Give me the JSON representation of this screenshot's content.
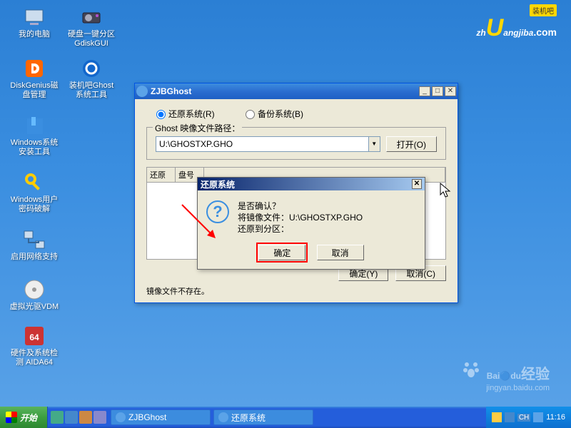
{
  "desktop": {
    "icons": [
      {
        "label": "我的电脑",
        "name": "my-computer"
      },
      {
        "label": "硬盘一键分区GdiskGUI",
        "name": "gdisk-gui"
      },
      {
        "label": "DiskGenius磁盘管理",
        "name": "diskgenius"
      },
      {
        "label": "装机吧Ghost系统工具",
        "name": "zjb-ghost-tool"
      },
      {
        "label": "Windows系统安装工具",
        "name": "windows-install"
      },
      {
        "label": "Windows用户密码破解",
        "name": "password-crack"
      },
      {
        "label": "启用网络支持",
        "name": "enable-network"
      },
      {
        "label": "虚拟光驱VDM",
        "name": "virtual-drive"
      },
      {
        "label": "硬件及系统检测 AIDA64",
        "name": "aida64"
      }
    ]
  },
  "watermark": {
    "logo_pre": "zh",
    "logo_u": "U",
    "logo_post": "angjiba",
    "logo_com": ".com",
    "badge": "装机吧",
    "bottom_brand_pre": "Bai",
    "bottom_brand_post": "du",
    "bottom_brand_cn": "经验",
    "bottom_url": "jingyan.baidu.com"
  },
  "main_window": {
    "title": "ZJBGhost",
    "mode": {
      "restore": "还原系统(R)",
      "backup": "备份系统(B)"
    },
    "path_group_label": "Ghost 映像文件路径：",
    "path_value": "U:\\GHOSTXP.GHO",
    "open_btn": "打开(O)",
    "columns": {
      "c1": "还原",
      "c2": "盘号"
    },
    "ok_btn": "确定(Y)",
    "cancel_btn": "取消(C)",
    "status": "镜像文件不存在。"
  },
  "confirm_dialog": {
    "title": "还原系统",
    "line1": "是否确认？",
    "line2": "将镜像文件：U:\\GHOSTXP.GHO",
    "line3": "还原到分区：",
    "ok": "确定",
    "cancel": "取消"
  },
  "taskbar": {
    "start": "开始",
    "task1": "ZJBGhost",
    "task2": "还原系统",
    "lang": "CH",
    "clock": "11:16"
  }
}
